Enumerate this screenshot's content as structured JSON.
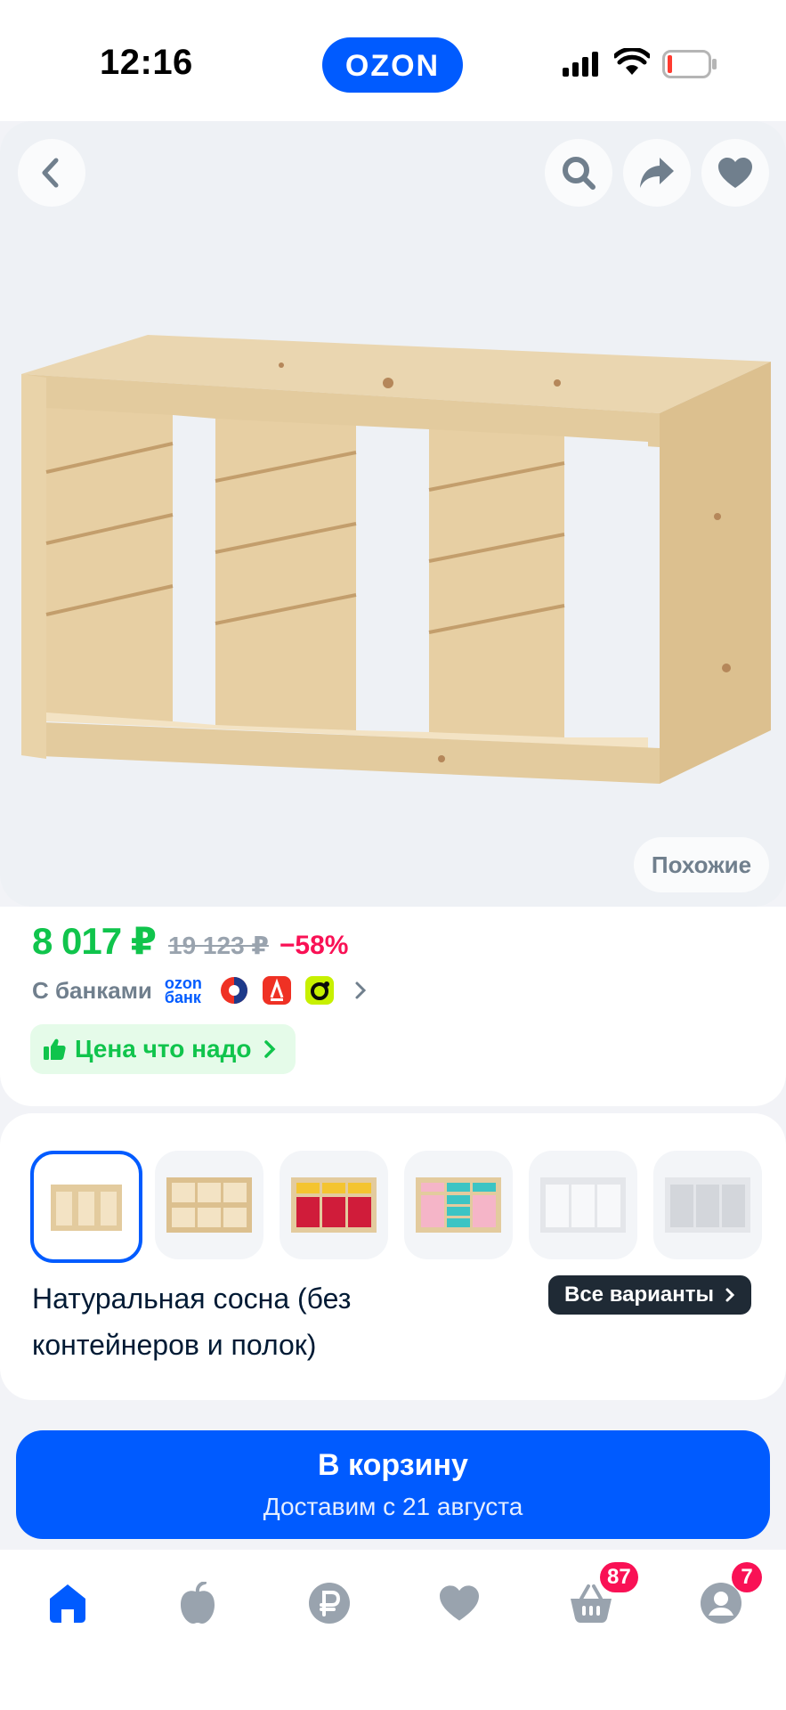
{
  "status_bar": {
    "time": "12:16",
    "brand": "OZON"
  },
  "gallery": {
    "similar_label": "Похожие",
    "image_alt": "wooden-shelf-frame"
  },
  "price": {
    "current": "8 017 ₽",
    "old": "19 123 ₽",
    "discount": "−58%",
    "banks_label": "С банками",
    "bank_ozon_line1": "ozon",
    "bank_ozon_line2": "банк",
    "promo": "Цена что надо"
  },
  "variants": {
    "selected_name": "Натуральная сосна (без контейнеров и полок)",
    "all_variants_label": "Все варианты"
  },
  "cart": {
    "title": "В корзину",
    "subtitle": "Доставим с 21 августа"
  },
  "nav": {
    "cart_badge": "87",
    "profile_badge": "7"
  },
  "colors": {
    "brand": "#005bff",
    "price_green": "#10c44c",
    "discount_pink": "#f91155"
  }
}
